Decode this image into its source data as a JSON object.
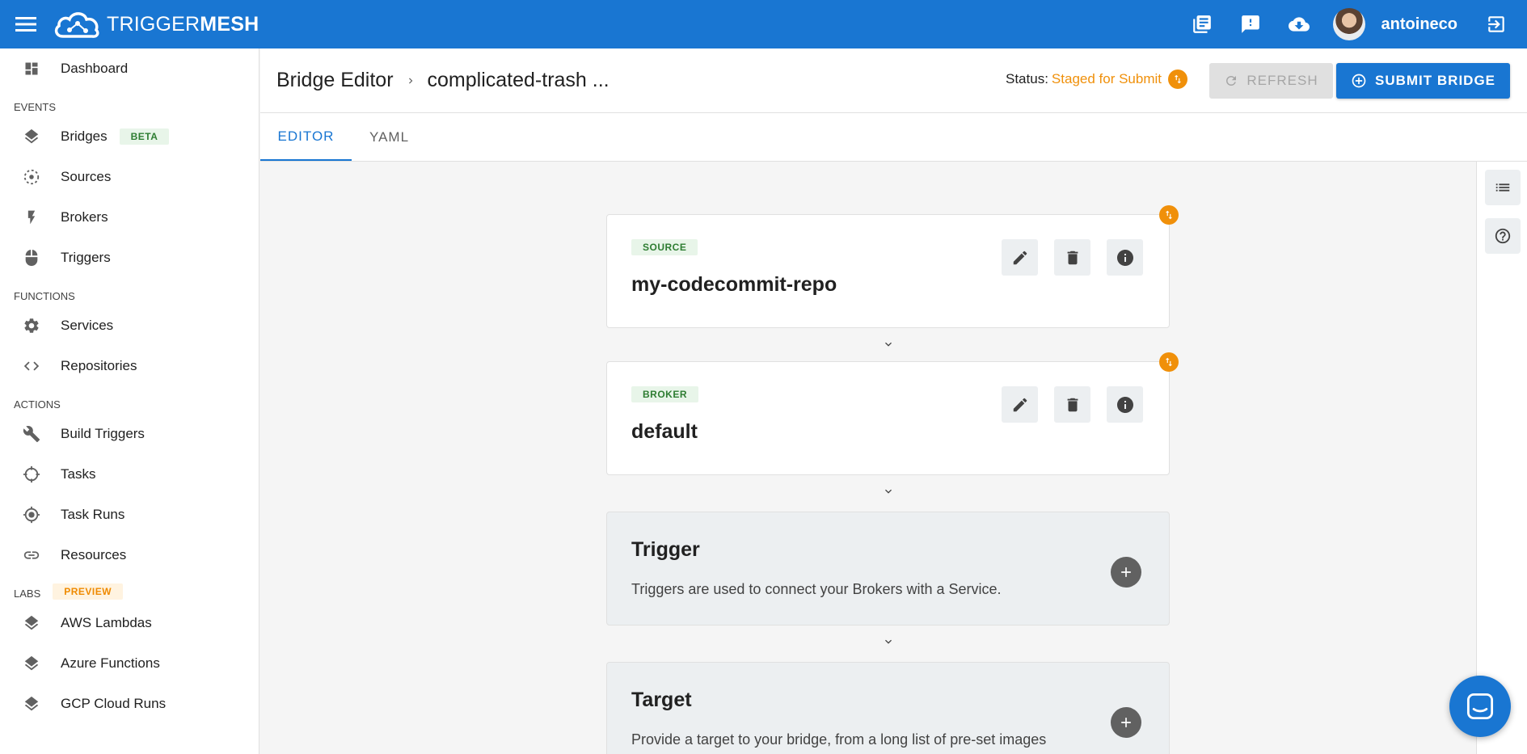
{
  "app": {
    "logo_light": "TRIGGER",
    "logo_bold": "MESH",
    "username": "antoineco",
    "accent": "#1976d2",
    "warning": "#f0900a"
  },
  "sidebar": {
    "top": [
      {
        "label": "Dashboard",
        "icon": "dashboard-icon"
      }
    ],
    "sections": [
      {
        "label": "EVENTS",
        "items": [
          {
            "label": "Bridges",
            "icon": "layers-icon",
            "badge": "BETA"
          },
          {
            "label": "Sources",
            "icon": "source-target-icon"
          },
          {
            "label": "Brokers",
            "icon": "bolt-icon"
          },
          {
            "label": "Triggers",
            "icon": "mouse-icon"
          }
        ]
      },
      {
        "label": "FUNCTIONS",
        "items": [
          {
            "label": "Services",
            "icon": "gear-icon"
          },
          {
            "label": "Repositories",
            "icon": "code-icon"
          }
        ]
      },
      {
        "label": "ACTIONS",
        "items": [
          {
            "label": "Build Triggers",
            "icon": "wrench-icon"
          },
          {
            "label": "Tasks",
            "icon": "crosshair-icon"
          },
          {
            "label": "Task Runs",
            "icon": "gps-icon"
          },
          {
            "label": "Resources",
            "icon": "link-icon"
          }
        ]
      },
      {
        "label": "LABS",
        "badge": "PREVIEW",
        "items": [
          {
            "label": "AWS Lambdas",
            "icon": "layers-icon"
          },
          {
            "label": "Azure Functions",
            "icon": "layers-icon"
          },
          {
            "label": "GCP Cloud Runs",
            "icon": "layers-icon"
          }
        ]
      }
    ]
  },
  "header": {
    "breadcrumb_root": "Bridge Editor",
    "breadcrumb_current": "complicated-trash ...",
    "status_label": "Status:",
    "status_value": "Staged for Submit",
    "refresh_label": "REFRESH",
    "submit_label": "SUBMIT BRIDGE"
  },
  "tabs": [
    {
      "label": "EDITOR",
      "active": true
    },
    {
      "label": "YAML",
      "active": false
    }
  ],
  "bridge": {
    "source": {
      "kind": "SOURCE",
      "name": "my-codecommit-repo"
    },
    "broker": {
      "kind": "BROKER",
      "name": "default"
    },
    "trigger": {
      "title": "Trigger",
      "description": "Triggers are used to connect your Brokers with a Service."
    },
    "target": {
      "title": "Target",
      "description": "Provide a target to your bridge, from a long list of pre-set images"
    }
  }
}
